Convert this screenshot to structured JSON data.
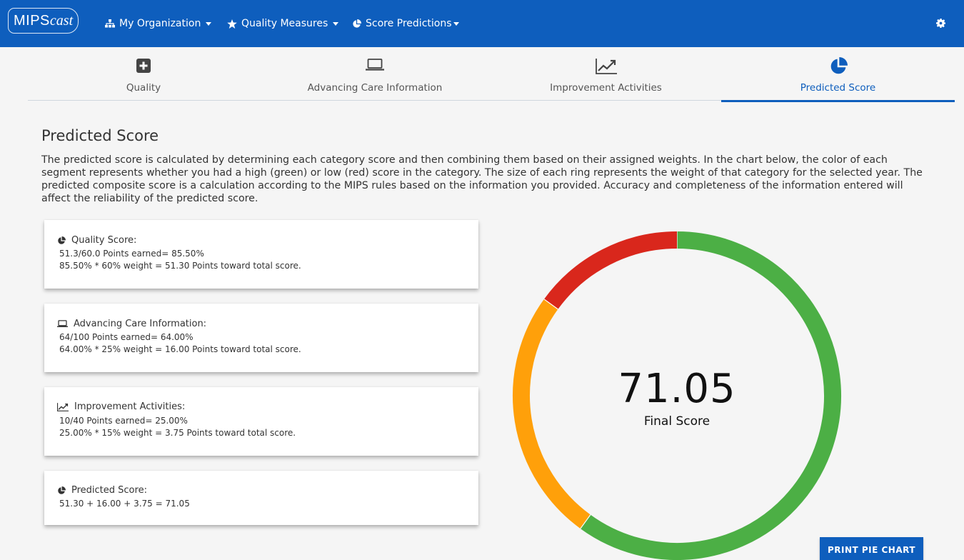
{
  "navbar": {
    "brand_prefix": "MIPS",
    "brand_suffix": "cast",
    "items": [
      {
        "label": "My Organization",
        "icon": "sitemap-icon"
      },
      {
        "label": "Quality Measures",
        "icon": "star-icon"
      },
      {
        "label": "Score Predictions",
        "icon": "pie-chart-icon"
      }
    ],
    "settings_icon": "gear-icon"
  },
  "tabs": [
    {
      "label": "Quality",
      "icon": "plus-square-icon",
      "active": false
    },
    {
      "label": "Advancing Care Information",
      "icon": "laptop-icon",
      "active": false
    },
    {
      "label": "Improvement Activities",
      "icon": "line-chart-icon",
      "active": false
    },
    {
      "label": "Predicted Score",
      "icon": "pie-chart-icon",
      "active": true
    }
  ],
  "page": {
    "title": "Predicted Score",
    "description": "The predicted score is calculated by determining each category score and then combining them based on their assigned weights. In the chart below, the color of each segment represents whether you had a high (green) or low (red) score in the category. The size of each ring represents the weight of that category for the selected year. The predicted composite score is a calculation according to the MIPS rules based on the information you provided. Accuracy and completeness of the information entered will affect the reliability of the predicted score."
  },
  "cards": [
    {
      "title": "Quality Score:",
      "icon": "pie-chart-icon",
      "lines": [
        "51.3/60.0 Points earned= 85.50%",
        "85.50% * 60% weight = 51.30 Points toward total score."
      ]
    },
    {
      "title": "Advancing Care Information:",
      "icon": "laptop-icon",
      "lines": [
        "64/100 Points earned= 64.00%",
        "64.00% * 25% weight = 16.00 Points toward total score."
      ]
    },
    {
      "title": "Improvement Activities:",
      "icon": "line-chart-icon",
      "lines": [
        "10/40 Points earned= 25.00%",
        "25.00% * 15% weight = 3.75 Points toward total score."
      ]
    },
    {
      "title": "Predicted Score:",
      "icon": "pie-chart-icon",
      "lines": [
        "51.30 + 16.00 + 3.75 = 71.05"
      ]
    }
  ],
  "score": {
    "value": "71.05",
    "label": "Final Score"
  },
  "chart_data": {
    "type": "pie",
    "categories": [
      "Quality",
      "Advancing Care Information",
      "Improvement Activities"
    ],
    "values": [
      60,
      25,
      15
    ],
    "colors": [
      "#4caf45",
      "#ffa00a",
      "#d9271c"
    ]
  },
  "actions": {
    "print_label": "PRINT PIE CHART"
  }
}
